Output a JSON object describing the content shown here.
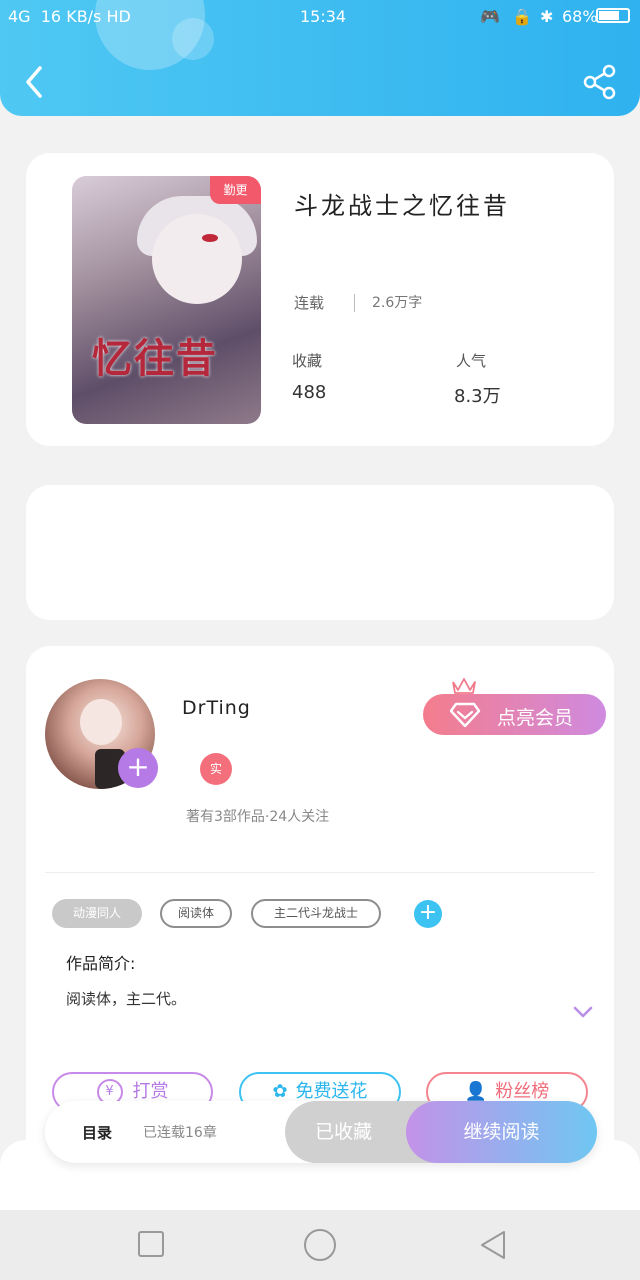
{
  "status_bar": {
    "left": "4G  16 KB/s HD",
    "time": "15:34",
    "battery": "68%"
  },
  "header": {
    "back_icon": "chevron-left-icon",
    "share_icon": "share-icon",
    "color": "#2fb2ef"
  },
  "book": {
    "cover_badge": "勤更",
    "cover_title": "忆往昔",
    "title": "斗龙战士之忆往昔",
    "status": "连载",
    "word_count": "2.6万字",
    "collect_label": "收藏",
    "collect_value": "488",
    "popularity_label": "人气",
    "popularity_value": "8.3万"
  },
  "author": {
    "name": "DrTing",
    "verified_badge": "实",
    "stats": "著有3部作品·24人关注",
    "vip_button": "点亮会员",
    "follow_icon": "plus-icon"
  },
  "tags": [
    "动漫同人",
    "阅读体",
    "主二代斗龙战士"
  ],
  "intro": {
    "heading": "作品简介:",
    "text": "阅读体，主二代。"
  },
  "actions": {
    "reward": "打赏",
    "flower": "免费送花",
    "fans": "粉丝榜"
  },
  "reader_bar": {
    "catalog": "目录",
    "progress": "已连载16章",
    "collected": "已收藏",
    "continue": "继续阅读"
  }
}
